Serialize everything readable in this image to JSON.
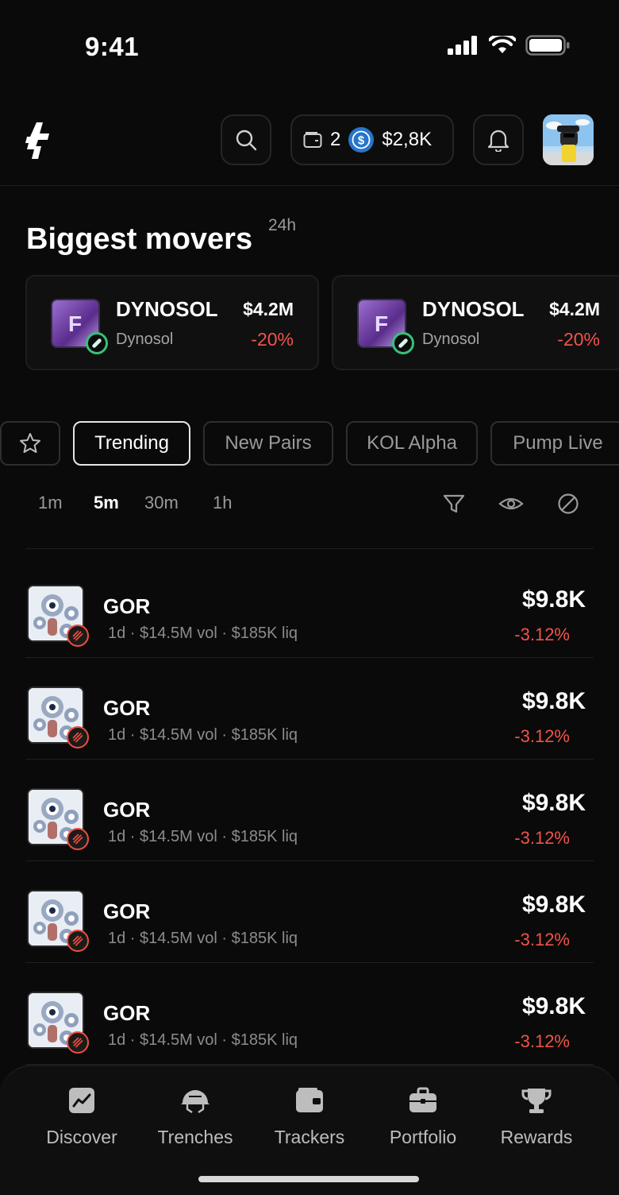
{
  "status_bar": {
    "time": "9:41"
  },
  "header": {
    "wallet_count": "2",
    "balance": "$2,8K"
  },
  "movers": {
    "title": "Biggest movers",
    "period": "24h",
    "cards": [
      {
        "symbol": "DYNOSOL",
        "name": "Dynosol",
        "price": "$4.2M",
        "change": "-20%",
        "token_letter": "F"
      },
      {
        "symbol": "DYNOSOL",
        "name": "Dynosol",
        "price": "$4.2M",
        "change": "-20%",
        "token_letter": "F"
      }
    ]
  },
  "tabs": [
    "Trending",
    "New Pairs",
    "KOL Alpha",
    "Pump Live"
  ],
  "timeframes": [
    "1m",
    "5m",
    "30m",
    "1h"
  ],
  "active_timeframe": "5m",
  "tokens": [
    {
      "name": "GOR",
      "meta": "1d · $14.5M vol · $185K liq",
      "price": "$9.8K",
      "change": "-3.12%"
    },
    {
      "name": "GOR",
      "meta": "1d · $14.5M vol · $185K liq",
      "price": "$9.8K",
      "change": "-3.12%"
    },
    {
      "name": "GOR",
      "meta": "1d · $14.5M vol · $185K liq",
      "price": "$9.8K",
      "change": "-3.12%"
    },
    {
      "name": "GOR",
      "meta": "1d · $14.5M vol · $185K liq",
      "price": "$9.8K",
      "change": "-3.12%"
    },
    {
      "name": "GOR",
      "meta": "1d · $14.5M vol · $185K liq",
      "price": "$9.8K",
      "change": "-3.12%"
    }
  ],
  "nav": [
    {
      "label": "Discover",
      "icon": "chart-icon"
    },
    {
      "label": "Trenches",
      "icon": "helmet-icon"
    },
    {
      "label": "Trackers",
      "icon": "wallet-icon"
    },
    {
      "label": "Portfolio",
      "icon": "briefcase-icon"
    },
    {
      "label": "Rewards",
      "icon": "trophy-icon"
    }
  ],
  "colors": {
    "negative": "#f0544a",
    "positive_badge": "#38c07a",
    "usdc": "#2775ca"
  }
}
